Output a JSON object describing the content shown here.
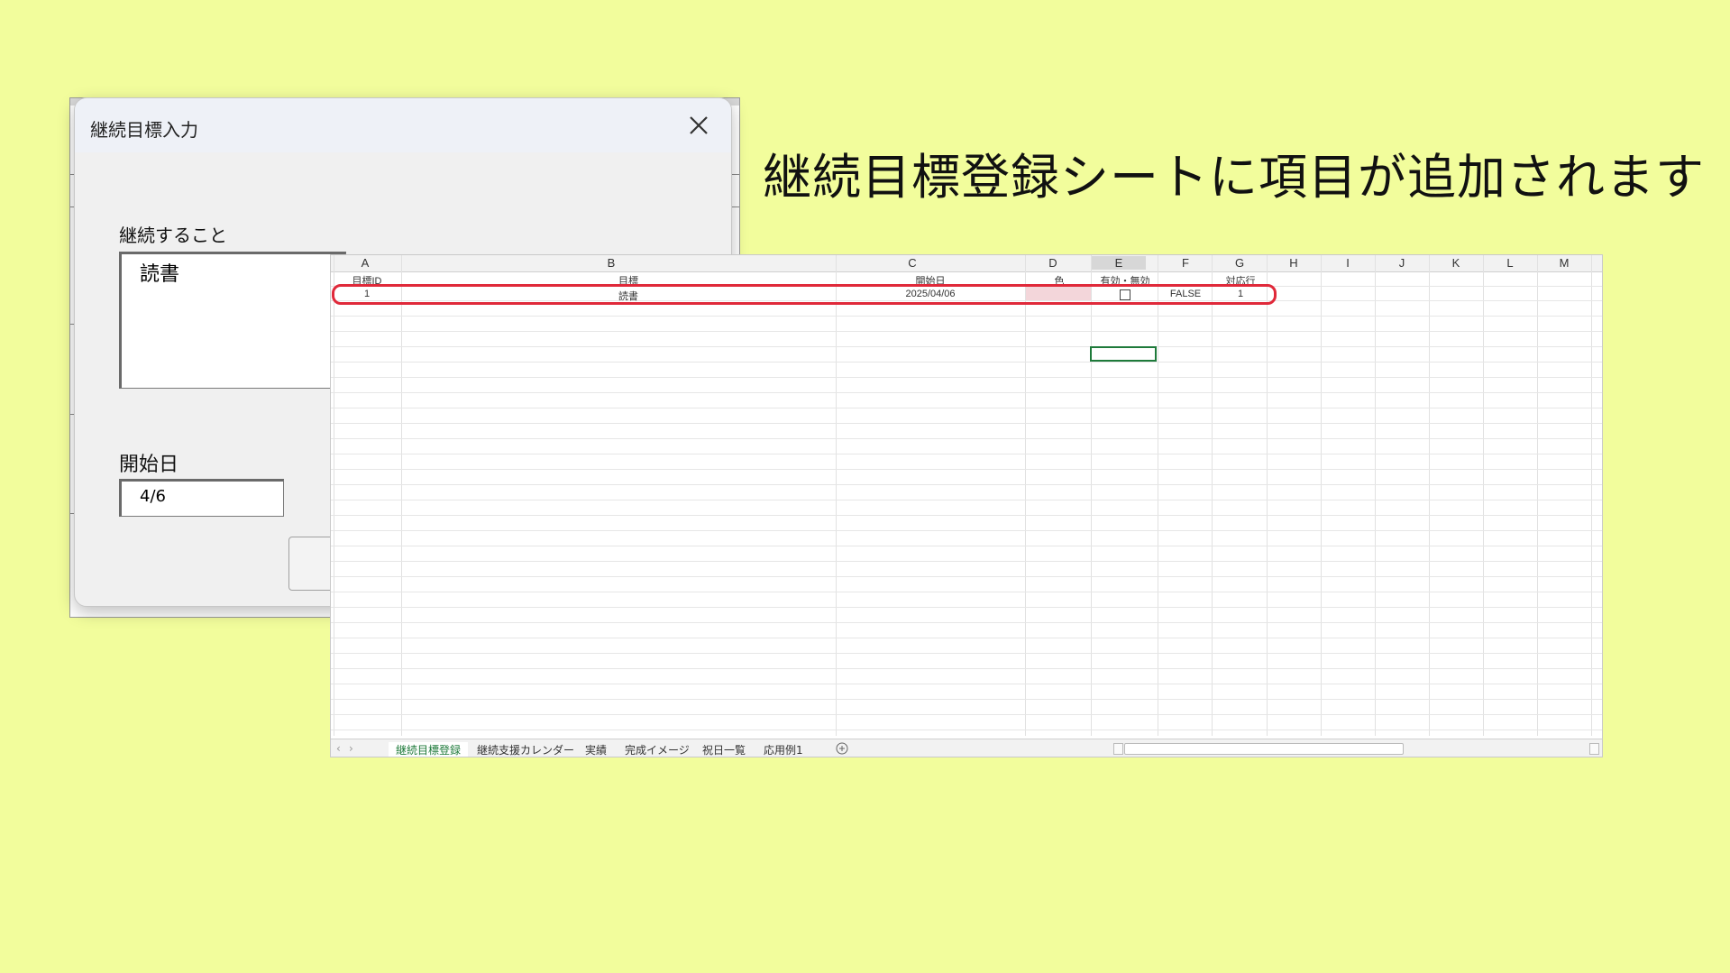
{
  "dialog": {
    "title": "継続目標入力",
    "goal_label": "継続すること",
    "goal_value": "読書",
    "start_label": "開始日",
    "start_value": "4/6"
  },
  "caption": "継続目標登録シートに項目が追加されます",
  "excel": {
    "columns": [
      "A",
      "B",
      "C",
      "D",
      "E",
      "F",
      "G",
      "H",
      "I",
      "J",
      "K",
      "L",
      "M"
    ],
    "headers": {
      "a": "目標ID",
      "b": "目標",
      "c": "開始日",
      "d": "色",
      "e": "有効・無効",
      "g": "対応行"
    },
    "row1": {
      "id": "1",
      "goal": "読書",
      "date": "2025/04/06",
      "flag": "FALSE",
      "row": "1"
    },
    "tabs": [
      "継続目標登録",
      "継続支援カレンダー",
      "実績",
      "完成イメージ",
      "祝日一覧",
      "応用例1"
    ],
    "active_tab_index": 0
  },
  "colors": {
    "background": "#f2fd9c",
    "highlight_outline": "#e0293a",
    "selection_border": "#1e7a3a",
    "color_cell": "#f3d6da"
  },
  "icons": [
    "close-icon",
    "add-sheet-icon",
    "scroll-left-icon",
    "scroll-right-icon",
    "checkbox-icon"
  ]
}
